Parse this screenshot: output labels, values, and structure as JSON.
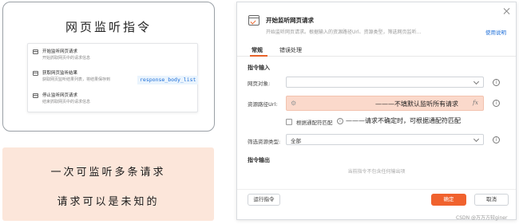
{
  "command_card": {
    "title": "网页监听指令",
    "items": [
      {
        "name": "开始监听网页请求",
        "desc": "开始抓取网页中的请求信息",
        "tag": ""
      },
      {
        "name": "获取网页监听结果",
        "desc": "获取网页监听结果列表，将结果保存到",
        "tag": "response_body_list"
      },
      {
        "name": "停止监听网页请求",
        "desc": "结束抓取网页中的请求信息",
        "tag": ""
      }
    ]
  },
  "note_box": {
    "line1": "一次可监听多条请求",
    "line2": "请求可以是未知的"
  },
  "dialog": {
    "title": "开始监听网页请求",
    "subtitle": "开始监听网页请求。根据输入的资源路径Url、资源类型，筛选网页监听...",
    "help_link": "使用说明",
    "tabs": [
      "常规",
      "错误处理"
    ],
    "section_input": "指令输入",
    "page_object_label": "网页对象:",
    "page_object_value": "",
    "resource_path_label": "资源路径Url:",
    "resource_path_note": "———不填默认监听所有请求",
    "fx_label": "fx",
    "wildcard_label": "根据通配符匹配",
    "wildcard_note": "———请求不确定时，可根据通配符匹配",
    "filter_type_label": "筛选资源类型:",
    "filter_type_value": "全部",
    "section_output": "指令输出",
    "output_empty": "当前指令不包含任何输出项",
    "run_button": "运行指令",
    "ok_button": "确定",
    "cancel_button": "取消"
  },
  "watermark": "CSDN @万万方较giner",
  "colors": {
    "accent": "#f0622e",
    "link": "#1e6fd9",
    "note_bg": "#fce6da",
    "input_highlight": "#fbd9cb"
  }
}
